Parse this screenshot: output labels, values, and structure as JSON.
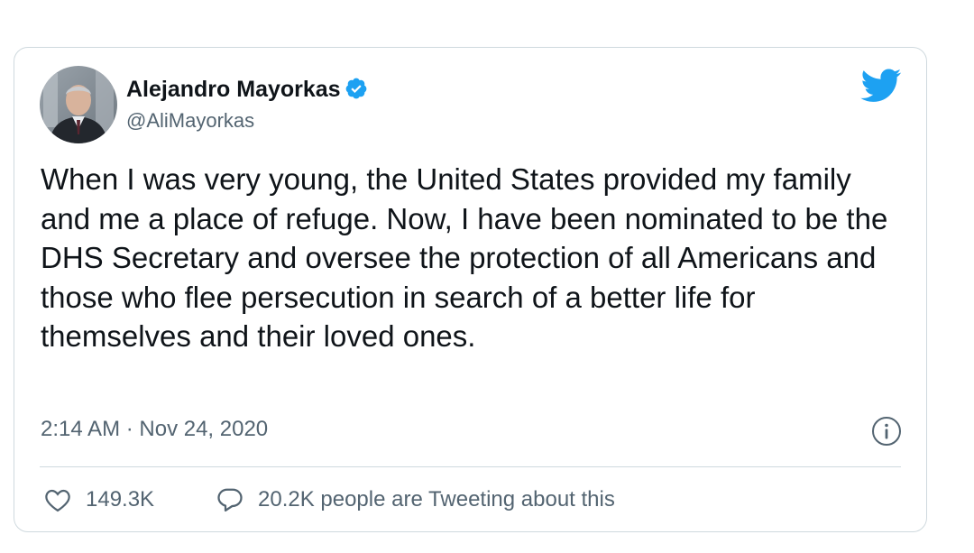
{
  "user": {
    "display_name": "Alejandro Mayorkas",
    "handle": "@AliMayorkas",
    "verified": true
  },
  "tweet": {
    "text": "When I was very young, the United States provided my family and me a place of refuge. Now, I have been nominated to be the DHS Secretary and oversee the protection of all Americans and those who flee persecution in search of a better life for themselves and their loved ones.",
    "timestamp": "2:14 AM · Nov 24, 2020"
  },
  "actions": {
    "likes": "149.3K",
    "conversation": "20.2K people are Tweeting about this"
  },
  "icons": {
    "brand": "twitter-bird-icon",
    "verified": "verified-badge-icon",
    "info": "info-icon",
    "like": "heart-icon",
    "reply": "speech-bubble-icon"
  },
  "colors": {
    "brand_blue": "#1da1f2",
    "text_primary": "#0f1419",
    "text_secondary": "#536471",
    "border": "#cfd9de"
  }
}
